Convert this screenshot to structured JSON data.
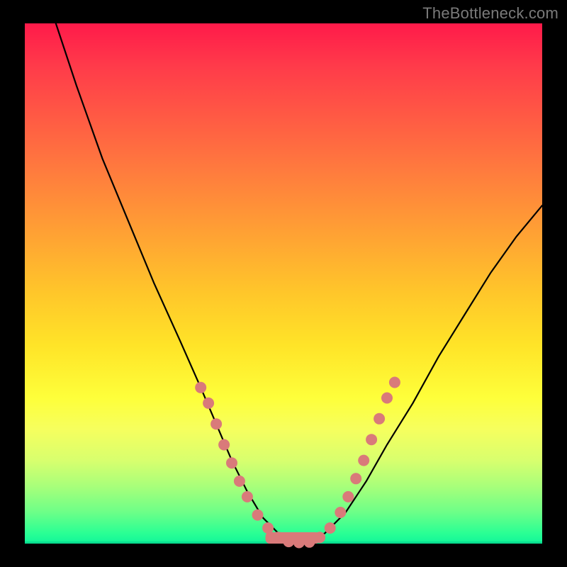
{
  "watermark": "TheBottleneck.com",
  "chart_data": {
    "type": "line",
    "title": "",
    "xlabel": "",
    "ylabel": "",
    "xlim": [
      0,
      100
    ],
    "ylim": [
      0,
      100
    ],
    "grid": false,
    "legend": null,
    "series": [
      {
        "name": "bottleneck-curve",
        "x": [
          6,
          10,
          15,
          20,
          25,
          30,
          34,
          37,
          40,
          43,
          46,
          50,
          54,
          58,
          62,
          66,
          70,
          75,
          80,
          85,
          90,
          95,
          100
        ],
        "y": [
          100,
          88,
          74,
          62,
          50,
          39,
          30,
          23,
          16,
          10,
          5,
          1,
          0,
          2,
          6,
          12,
          19,
          27,
          36,
          44,
          52,
          59,
          65
        ]
      }
    ],
    "markers": {
      "name": "salmon-dots",
      "color": "#d97a7a",
      "points": [
        {
          "x": 34,
          "y": 30
        },
        {
          "x": 35.5,
          "y": 27
        },
        {
          "x": 37,
          "y": 23
        },
        {
          "x": 38.5,
          "y": 19
        },
        {
          "x": 40,
          "y": 15.5
        },
        {
          "x": 41.5,
          "y": 12
        },
        {
          "x": 43,
          "y": 9
        },
        {
          "x": 45,
          "y": 5.5
        },
        {
          "x": 47,
          "y": 3
        },
        {
          "x": 49,
          "y": 1.2
        },
        {
          "x": 51,
          "y": 0.4
        },
        {
          "x": 53,
          "y": 0.2
        },
        {
          "x": 55,
          "y": 0.3
        },
        {
          "x": 57,
          "y": 1.2
        },
        {
          "x": 59,
          "y": 3
        },
        {
          "x": 61,
          "y": 6
        },
        {
          "x": 62.5,
          "y": 9
        },
        {
          "x": 64,
          "y": 12.5
        },
        {
          "x": 65.5,
          "y": 16
        },
        {
          "x": 67,
          "y": 20
        },
        {
          "x": 68.5,
          "y": 24
        },
        {
          "x": 70,
          "y": 28
        },
        {
          "x": 71.5,
          "y": 31
        }
      ]
    },
    "bottom_bar": {
      "name": "salmon-bar",
      "color": "#d97a7a",
      "x_start": 46.5,
      "x_end": 57,
      "height": 2.2
    }
  }
}
